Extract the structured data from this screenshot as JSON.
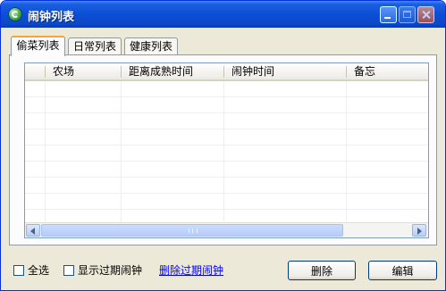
{
  "window": {
    "title": "闹钟列表"
  },
  "tabs": [
    {
      "label": "偷菜列表"
    },
    {
      "label": "日常列表"
    },
    {
      "label": "健康列表"
    }
  ],
  "table": {
    "columns": [
      "农场",
      "距离成熟时间",
      "闹钟时间",
      "备忘"
    ],
    "rows": []
  },
  "footer": {
    "select_all": "全选",
    "show_expired": "显示过期闹钟",
    "delete_expired_link": "删除过期闹钟",
    "delete_button": "删除",
    "edit_button": "编辑"
  }
}
